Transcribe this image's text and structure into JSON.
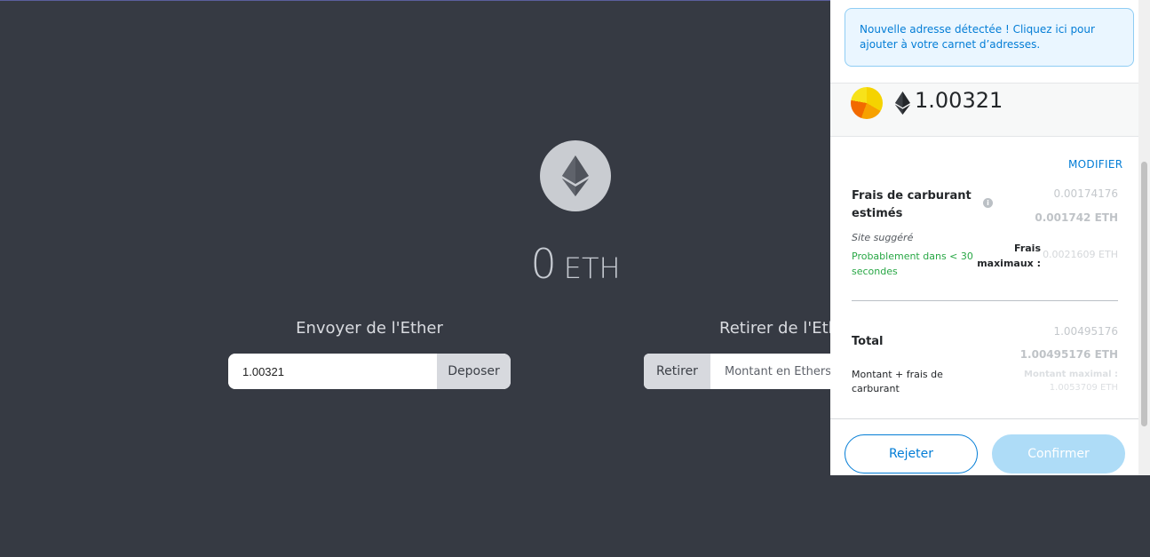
{
  "dapp": {
    "balance_value": "0",
    "balance_unit": "ETH",
    "send": {
      "title": "Envoyer de l'Ether",
      "input_value": "1.00321",
      "button_label": "Deposer"
    },
    "withdraw": {
      "title": "Retirer de l'Ethe",
      "button_label": "Retirer",
      "input_placeholder": "Montant en Ethers"
    }
  },
  "wallet": {
    "notice": "Nouvelle adresse détectée ! Cliquez ici pour ajouter à votre carnet d’adresses.",
    "amount": "1.00321",
    "modify_label": "MODIFIER",
    "gas": {
      "label": "Frais de carburant estimés",
      "secondary_value": "0.00174176",
      "primary_value": "0.001742 ETH",
      "site_suggested": "Site suggéré",
      "likely_time": "Probablement dans < 30 secondes",
      "max_fee_label": "Frais maximaux :",
      "max_fee_value": "0.0021609 ETH"
    },
    "total": {
      "label": "Total",
      "secondary_value": "1.00495176",
      "primary_value": "1.00495176 ETH",
      "sublabel": "Montant + frais de carburant",
      "max_amount_label": "Montant maximal :",
      "max_amount_value": "1.0053709 ETH"
    },
    "reject_label": "Rejeter",
    "confirm_label": "Confirmer"
  },
  "colors": {
    "background": "#363a43",
    "accent": "#037dd6",
    "success": "#28a745",
    "confirm_disabled": "#a6d9f7"
  },
  "icons": [
    "ethereum-logo-icon",
    "identicon-icon",
    "info-icon"
  ]
}
